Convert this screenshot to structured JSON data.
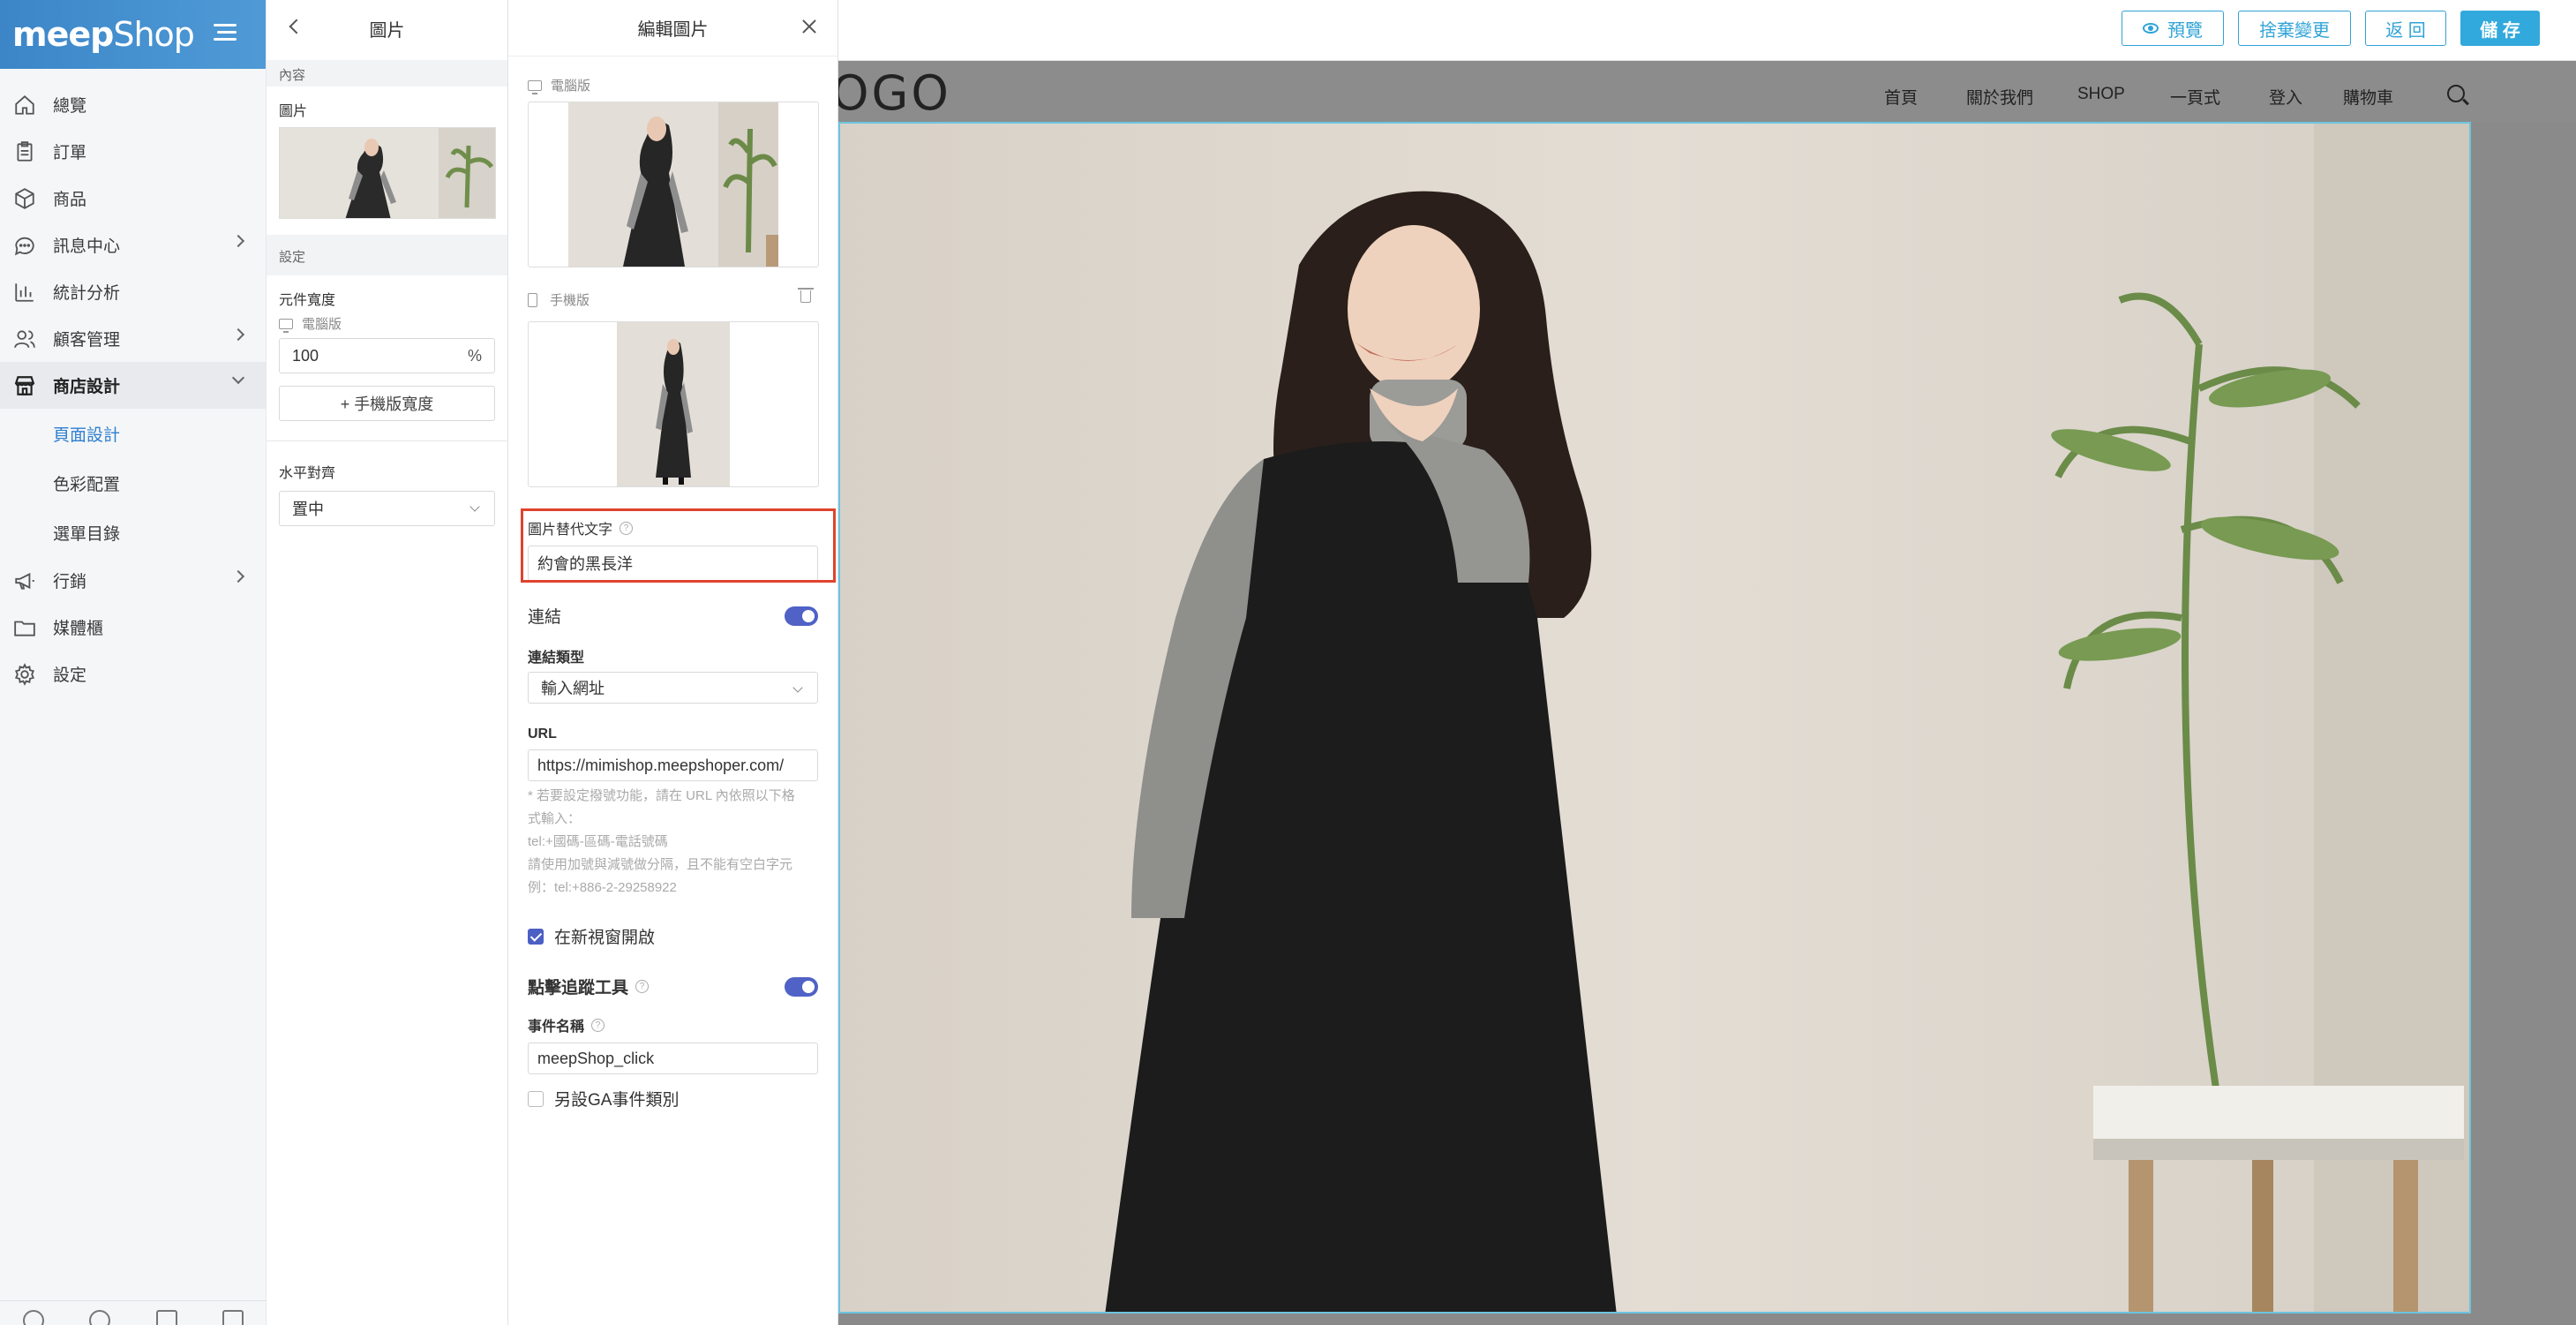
{
  "nav": {
    "brand": {
      "bold": "meep",
      "light": "Shop"
    },
    "items": [
      {
        "label": "總覽",
        "icon": "home-icon"
      },
      {
        "label": "訂單",
        "icon": "clipboard-icon"
      },
      {
        "label": "商品",
        "icon": "box-icon"
      },
      {
        "label": "訊息中心",
        "icon": "chat-icon"
      },
      {
        "label": "統計分析",
        "icon": "bar-chart-icon"
      },
      {
        "label": "顧客管理",
        "icon": "users-icon"
      },
      {
        "label": "商店設計",
        "icon": "store-icon"
      },
      {
        "label": "行銷",
        "icon": "megaphone-icon"
      },
      {
        "label": "媒體櫃",
        "icon": "folder-icon"
      },
      {
        "label": "設定",
        "icon": "gear-icon"
      }
    ],
    "sub_items": [
      "頁面設計",
      "色彩配置",
      "選單目錄"
    ]
  },
  "panel1": {
    "title": "圖片",
    "content_section": "內容",
    "image_label": "圖片",
    "settings_section": "設定",
    "width_label": "元件寬度",
    "desktop_label": "電腦版",
    "width_value": "100",
    "width_unit": "%",
    "mobile_width_button": "+ 手機版寬度",
    "align_label": "水平對齊",
    "align_value": "置中"
  },
  "panel2": {
    "title": "編輯圖片",
    "desktop_label": "電腦版",
    "mobile_label": "手機版",
    "alt_label": "圖片替代文字",
    "alt_value": "約會的黑長洋",
    "link_label": "連結",
    "link_enabled": true,
    "link_type_label": "連結類型",
    "link_type_value": "輸入網址",
    "url_label": "URL",
    "url_value": "https://mimishop.meepshoper.com/",
    "hint_lines": [
      "* 若要設定撥號功能，請在 URL 內依照以下格",
      "式輸入：",
      "tel:+國碼-區碼-電話號碼",
      "請使用加號與減號做分隔，且不能有空白字元",
      "例：tel:+886-2-29258922"
    ],
    "new_window_label": "在新視窗開啟",
    "new_window_checked": true,
    "tracking_label": "點擊追蹤工具",
    "tracking_enabled": true,
    "event_name_label": "事件名稱",
    "event_name_value": "meepShop_click",
    "ga_category_label": "另設GA事件類別",
    "ga_category_checked": false
  },
  "preview": {
    "buttons": {
      "preview": "預覽",
      "discard": "捨棄變更",
      "back": "返 回",
      "save": "儲 存"
    },
    "site_logo": "OGO",
    "site_nav": [
      "首頁",
      "關於我們",
      "SHOP",
      "一頁式",
      "登入",
      "購物車"
    ]
  },
  "colors": {
    "brand_blue": "#3c86c8",
    "accent_cyan": "#2fa3d6",
    "toggle_indigo": "#5062c6",
    "highlight_red": "#e0432e"
  }
}
